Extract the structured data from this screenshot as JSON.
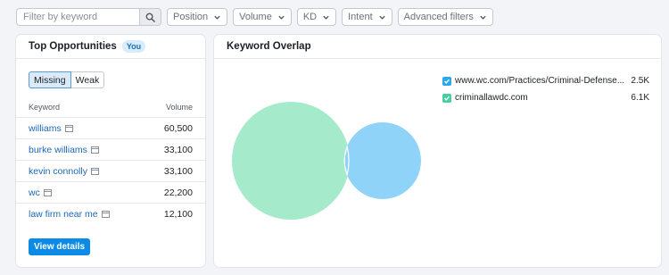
{
  "filters": {
    "search_placeholder": "Filter by keyword",
    "dropdowns": [
      "Position",
      "Volume",
      "KD",
      "Intent",
      "Advanced filters"
    ]
  },
  "opportunities": {
    "title": "Top Opportunities",
    "badge": "You",
    "tabs": [
      "Missing",
      "Weak"
    ],
    "active_tab": "Missing",
    "columns": [
      "Keyword",
      "Volume"
    ],
    "rows": [
      {
        "keyword": "williams",
        "volume": "60,500"
      },
      {
        "keyword": "burke williams",
        "volume": "33,100"
      },
      {
        "keyword": "kevin connolly",
        "volume": "33,100"
      },
      {
        "keyword": "wc",
        "volume": "22,200"
      },
      {
        "keyword": "law firm near me",
        "volume": "12,100"
      }
    ],
    "view_details_label": "View details"
  },
  "overlap": {
    "title": "Keyword Overlap",
    "legend": [
      {
        "label": "www.wc.com/Practices/Criminal-Defense...",
        "value": "2.5K",
        "color": "#2aa8e8"
      },
      {
        "label": "criminallawdc.com",
        "value": "6.1K",
        "color": "#45d0a0"
      }
    ]
  },
  "colors": {
    "accent": "#0b8ae6",
    "link": "#1e67b8",
    "venn_green": "#a5ebcb",
    "venn_blue": "#8fd4f8"
  },
  "icons": {
    "search": "search-icon",
    "chevron": "chevron-down-icon",
    "calendar": "calendar-icon",
    "check": "check-icon"
  }
}
